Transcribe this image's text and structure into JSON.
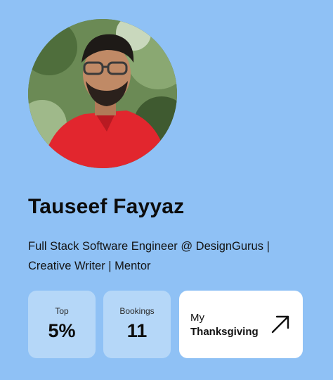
{
  "profile": {
    "name": "Tauseef Fayyaz",
    "bio_line1": "Full Stack Software Engineer @ DesignGurus |",
    "bio_line2": "Creative Writer | Mentor",
    "avatar_icon": "profile-photo"
  },
  "stats": [
    {
      "label": "Top",
      "value": "5%"
    },
    {
      "label": "Bookings",
      "value": "11"
    }
  ],
  "cta": {
    "line1": "My",
    "line2": "Thanksgiving",
    "icon": "arrow-up-right-icon"
  },
  "colors": {
    "background": "#8fc1f5",
    "stat_card": "#b5d7f8",
    "cta_card": "#ffffff",
    "shirt": "#e2262e"
  }
}
